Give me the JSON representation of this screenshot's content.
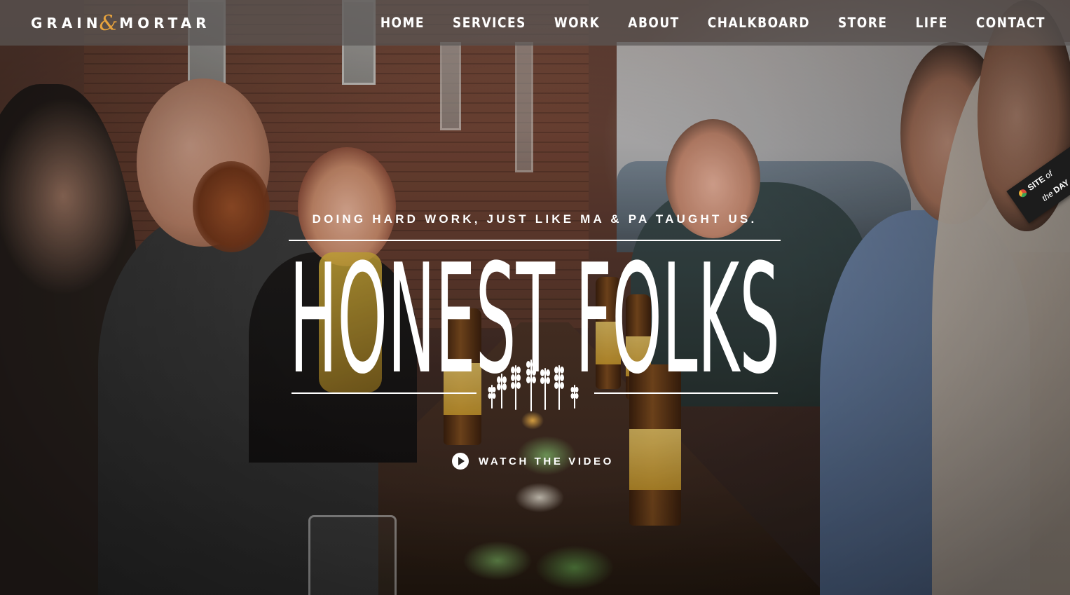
{
  "brand": {
    "logo_left": "GRAIN",
    "logo_amp": "&",
    "logo_right": "MORTAR",
    "accent_color": "#e8a33d"
  },
  "nav": {
    "items": [
      {
        "label": "HOME"
      },
      {
        "label": "SERVICES"
      },
      {
        "label": "WORK"
      },
      {
        "label": "ABOUT"
      },
      {
        "label": "CHALKBOARD"
      },
      {
        "label": "STORE"
      },
      {
        "label": "LIFE"
      },
      {
        "label": "CONTACT"
      }
    ]
  },
  "hero": {
    "tagline": "DOING HARD WORK, JUST LIKE MA & PA TAUGHT US.",
    "headline": "HONEST FOLKS",
    "cta_label": "WATCH THE VIDEO",
    "cta_icon": "play-icon"
  },
  "badge": {
    "line1_bold": "SITE",
    "line1_thin": "of",
    "line2_thin": "the",
    "line2_bold": "DAY",
    "icon": "awwwards-icon"
  }
}
